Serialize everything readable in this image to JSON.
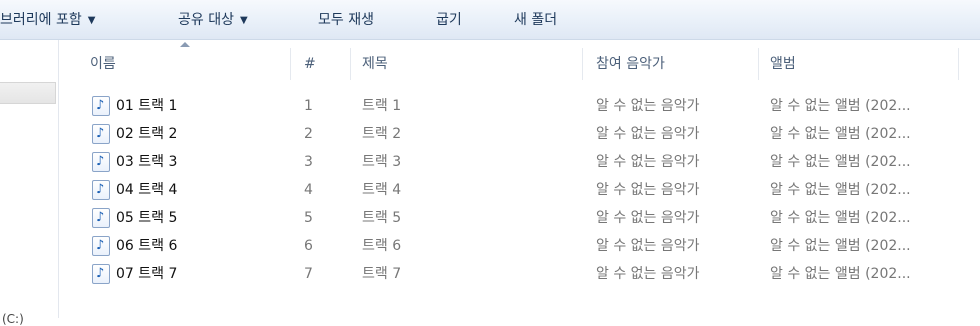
{
  "toolbar": {
    "include_library": "브러리에 포함",
    "share_with": "공유 대상",
    "play_all": "모두 재생",
    "burn": "굽기",
    "new_folder": "새 폴더"
  },
  "nav": {
    "drive_label": "(C:)"
  },
  "columns": {
    "name": "이름",
    "number": "#",
    "title": "제목",
    "artist": "참여 음악가",
    "album": "앨범"
  },
  "files": [
    {
      "name": "01 트랙 1",
      "number": "1",
      "title": "트랙 1",
      "artist": "알 수 없는 음악가",
      "album": "알 수 없는 앨범 (202..."
    },
    {
      "name": "02 트랙 2",
      "number": "2",
      "title": "트랙 2",
      "artist": "알 수 없는 음악가",
      "album": "알 수 없는 앨범 (202..."
    },
    {
      "name": "03 트랙 3",
      "number": "3",
      "title": "트랙 3",
      "artist": "알 수 없는 음악가",
      "album": "알 수 없는 앨범 (202..."
    },
    {
      "name": "04 트랙 4",
      "number": "4",
      "title": "트랙 4",
      "artist": "알 수 없는 음악가",
      "album": "알 수 없는 앨범 (202..."
    },
    {
      "name": "05 트랙 5",
      "number": "5",
      "title": "트랙 5",
      "artist": "알 수 없는 음악가",
      "album": "알 수 없는 앨범 (202..."
    },
    {
      "name": "06 트랙 6",
      "number": "6",
      "title": "트랙 6",
      "artist": "알 수 없는 음악가",
      "album": "알 수 없는 앨범 (202..."
    },
    {
      "name": "07 트랙 7",
      "number": "7",
      "title": "트랙 7",
      "artist": "알 수 없는 음악가",
      "album": "알 수 없는 앨범 (202..."
    }
  ],
  "icons": {
    "dropdown": "chevron-down-icon",
    "sort": "sort-ascending-icon",
    "file": "music-file-icon"
  }
}
